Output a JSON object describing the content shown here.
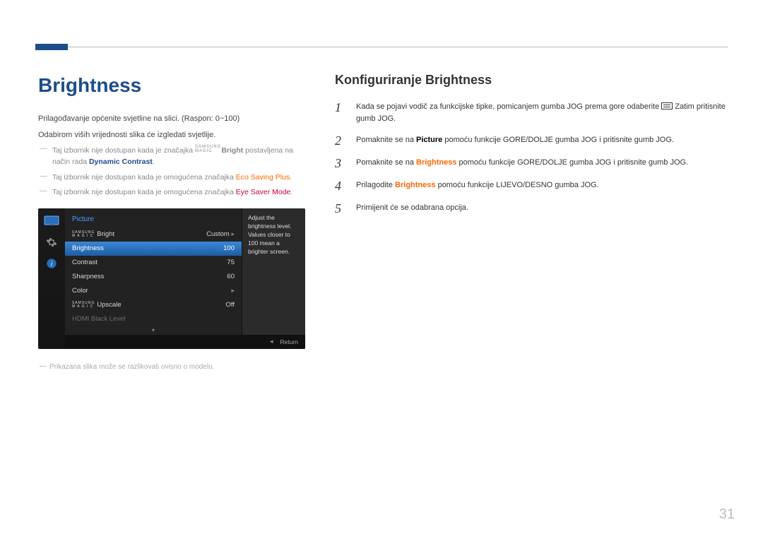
{
  "page": {
    "number": "31",
    "title": "Brightness",
    "subtitle": "Konfiguriranje Brightness"
  },
  "left": {
    "intro1": "Prilagođavanje općenite svjetline na slici. (Raspon: 0~100)",
    "intro2": "Odabirom viših vrijednosti slika će izgledati svjetlije.",
    "note1_a": "Taj izbornik nije dostupan kada je značajka ",
    "note1_brand": "SAMSUNG",
    "note1_brand2": "MAGIC",
    "note1_b": "Bright",
    "note1_c": " postavljena na način rada ",
    "note1_hl": "Dynamic Contrast",
    "note1_d": ".",
    "note2_a": "Taj izbornik nije dostupan kada je omogućena značajka ",
    "note2_hl": "Eco Saving Plus",
    "note2_b": ".",
    "note3_a": "Taj izbornik nije dostupan kada je omogućena značajka ",
    "note3_hl": "Eye Saver Mode",
    "note3_b": ".",
    "caption": "Prikazana slika može se razlikovati ovisno o modelu."
  },
  "steps": [
    {
      "a": "Kada se pojavi vodič za funkcijske tipke, pomicanjem gumba JOG prema gore odaberite ",
      "b": "Zatim pritisnite gumb JOG."
    },
    {
      "a": "Pomaknite se na ",
      "hl": "Picture",
      "b": " pomoću funkcije GORE/DOLJE gumba JOG i pritisnite gumb JOG."
    },
    {
      "a": "Pomaknite se na ",
      "hl": "Brightness",
      "b": " pomoću funkcije GORE/DOLJE gumba JOG i pritisnite gumb JOG."
    },
    {
      "a": "Prilagodite ",
      "hl": "Brightness",
      "b": " pomoću funkcije LIJEVO/DESNO gumba JOG."
    },
    {
      "a": "Primijenit će se odabrana opcija."
    }
  ],
  "osd": {
    "title": "Picture",
    "help": "Adjust the brightness level. Values closer to 100 mean a brighter screen.",
    "rows": [
      {
        "label": "Bright",
        "magic": true,
        "value": "Custom",
        "arrow": true
      },
      {
        "label": "Brightness",
        "value": "100",
        "selected": true
      },
      {
        "label": "Contrast",
        "value": "75"
      },
      {
        "label": "Sharpness",
        "value": "60"
      },
      {
        "label": "Color",
        "value": "",
        "arrow": true
      },
      {
        "label": "Upscale",
        "magic": true,
        "value": "Off"
      },
      {
        "label": "HDMI Black Level",
        "value": "",
        "disabled": true
      }
    ],
    "return": "Return"
  }
}
